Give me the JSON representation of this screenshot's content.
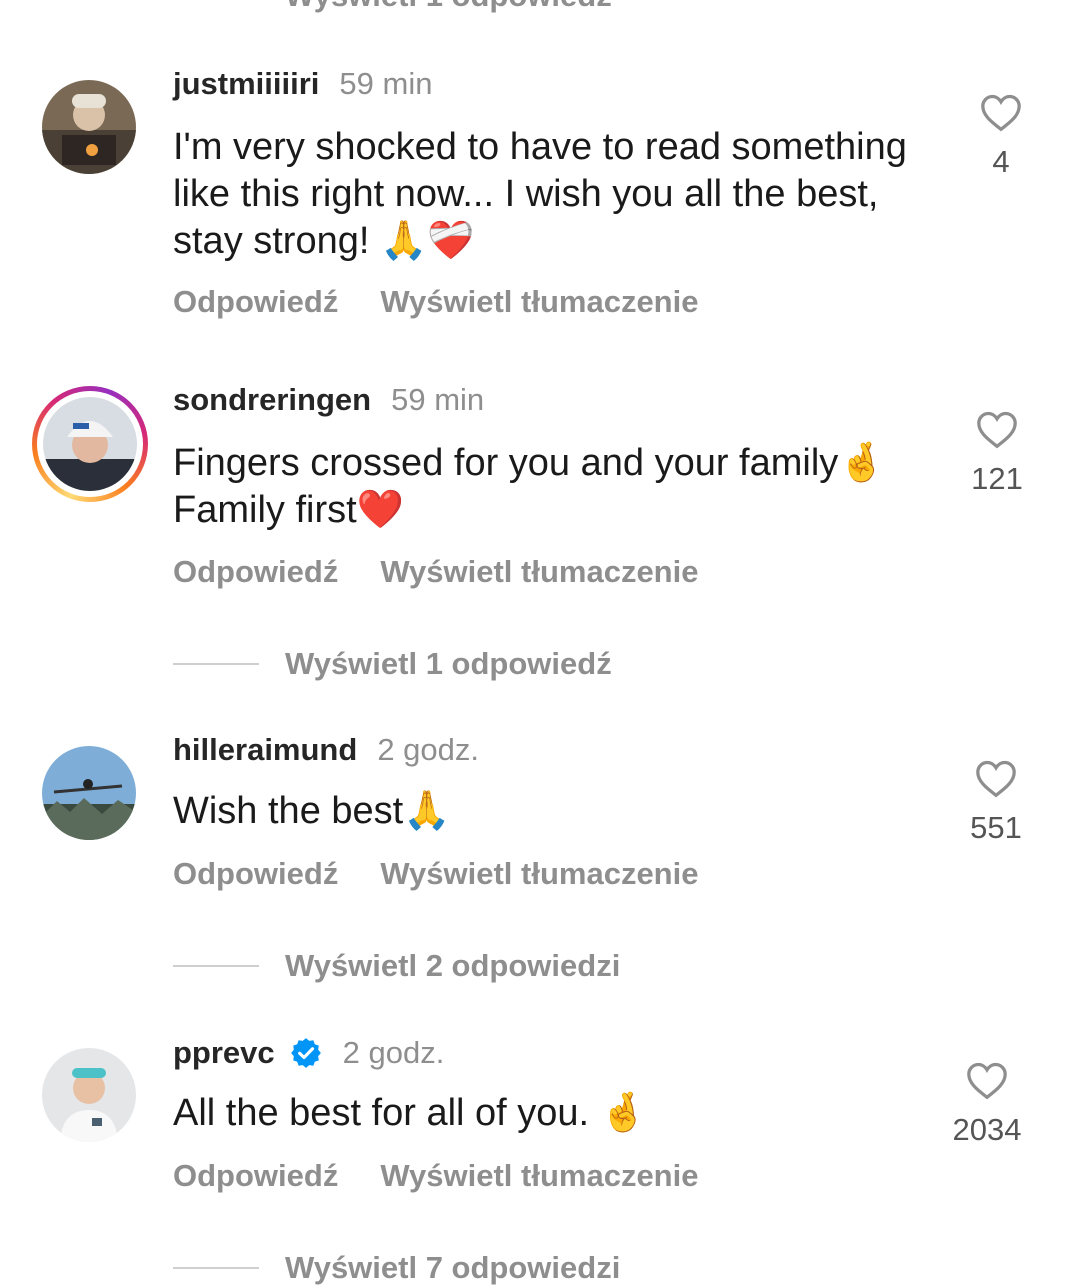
{
  "top_replies_label": "Wyświetl 1 odpowiedź",
  "action_reply": "Odpowiedź",
  "action_translate": "Wyświetl tłumaczenie",
  "comments": [
    {
      "username": "justmiiiiiri",
      "time": "59 min",
      "text": "I'm very shocked to have to read something like this right now... I wish you all the best, stay strong! 🙏❤️‍🩹",
      "likes": "4",
      "replies": "",
      "verified": false,
      "story_ring": false
    },
    {
      "username": "sondreringen",
      "time": "59 min",
      "text": "Fingers crossed for you and your family🤞 Family first❤️",
      "likes": "121",
      "replies": "Wyświetl 1 odpowiedź",
      "verified": false,
      "story_ring": true
    },
    {
      "username": "hilleraimund",
      "time": "2 godz.",
      "text": "Wish the best🙏",
      "likes": "551",
      "replies": "Wyświetl 2 odpowiedzi",
      "verified": false,
      "story_ring": false
    },
    {
      "username": "pprevc",
      "time": "2 godz.",
      "text": "All the best for all of you. 🤞",
      "likes": "2034",
      "replies": "Wyświetl 7 odpowiedzi",
      "verified": true,
      "story_ring": false
    }
  ],
  "colors": {
    "muted": "#8e8e8e",
    "text": "#1a1a1a",
    "verified": "#0095f6"
  }
}
